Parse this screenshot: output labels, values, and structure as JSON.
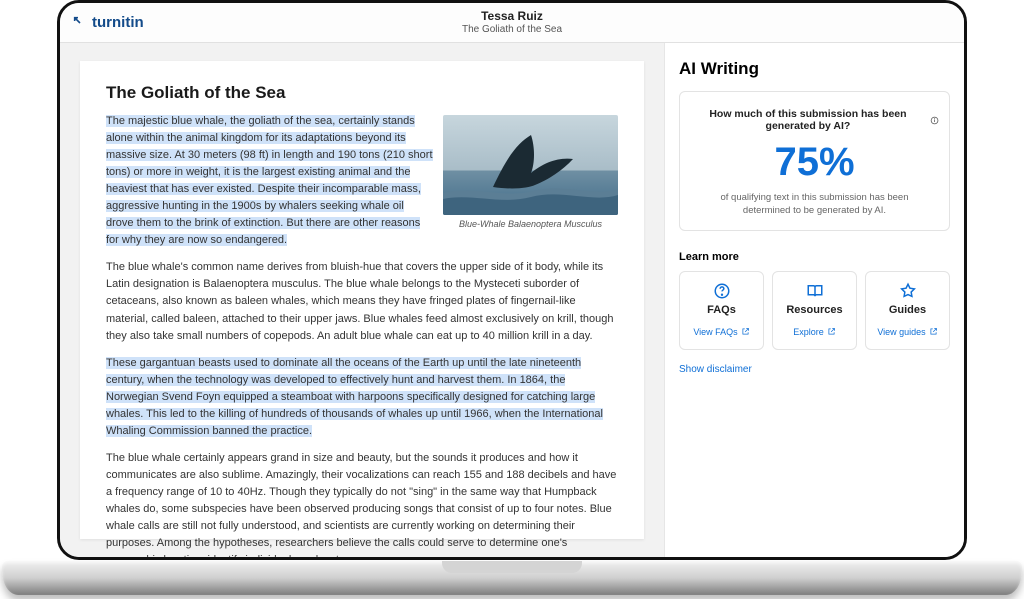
{
  "header": {
    "brand": "turnitin",
    "user": "Tessa Ruiz",
    "doc_title": "The Goliath of the Sea"
  },
  "document": {
    "title": "The Goliath of the Sea",
    "figure_caption": "Blue-Whale Balaenoptera Musculus",
    "para1": "The majestic blue whale, the goliath of the sea, certainly stands alone within the animal kingdom for its adaptations beyond its massive size. At 30 meters (98 ft) in length and 190 tons (210 short tons) or more in weight, it is the largest existing animal and the heaviest that has ever existed. Despite their incomparable mass, aggressive hunting in the 1900s by whalers seeking whale oil drove them to the brink of extinction. But there are other reasons for why they are now so endangered.",
    "para2": "The blue whale's common name derives from bluish-hue that covers the upper side of it body, while its Latin designation is Balaenoptera musculus. The blue whale belongs to the Mysteceti suborder of cetaceans, also known as baleen whales, which means they have fringed plates of fingernail-like material, called baleen, attached to their upper jaws. Blue whales feed almost exclusively on krill, though they also take small numbers of copepods. An adult blue whale can eat up to 40 million krill in a day.",
    "para3": "These gargantuan beasts used to dominate all the oceans of the Earth up until the late nineteenth century, when the technology was developed to effectively hunt and harvest them. In 1864, the Norwegian Svend Foyn equipped a steamboat with harpoons specifically designed for catching large whales. This led to the killing of hundreds of thousands of whales up until 1966, when the International Whaling Commission banned the practice.",
    "para4": "The blue whale certainly appears grand in size and beauty, but the sounds it produces and how it communicates are also sublime. Amazingly, their vocalizations can reach 155 and 188 decibels and have a frequency range of 10 to 40Hz. Though they typically do not \"sing\" in the same way that Humpback whales do, some subspecies have been observed producing songs that consist of up to four notes. Blue whale calls are still not fully understood, and scientists are currently working on determining their purposes. Among the hypotheses, researchers believe the calls could serve to determine one's geographic location, identify individuals, or locate prey."
  },
  "side": {
    "title": "AI Writing",
    "metric_question": "How much of this submission has been generated by AI?",
    "metric_value": "75%",
    "metric_subtext": "of qualifying text in this submission has been determined to be generated by AI.",
    "learn_more_label": "Learn more",
    "cards": [
      {
        "name": "FAQs",
        "link": "View FAQs"
      },
      {
        "name": "Resources",
        "link": "Explore"
      },
      {
        "name": "Guides",
        "link": "View guides"
      }
    ],
    "disclaimer": "Show disclaimer"
  }
}
